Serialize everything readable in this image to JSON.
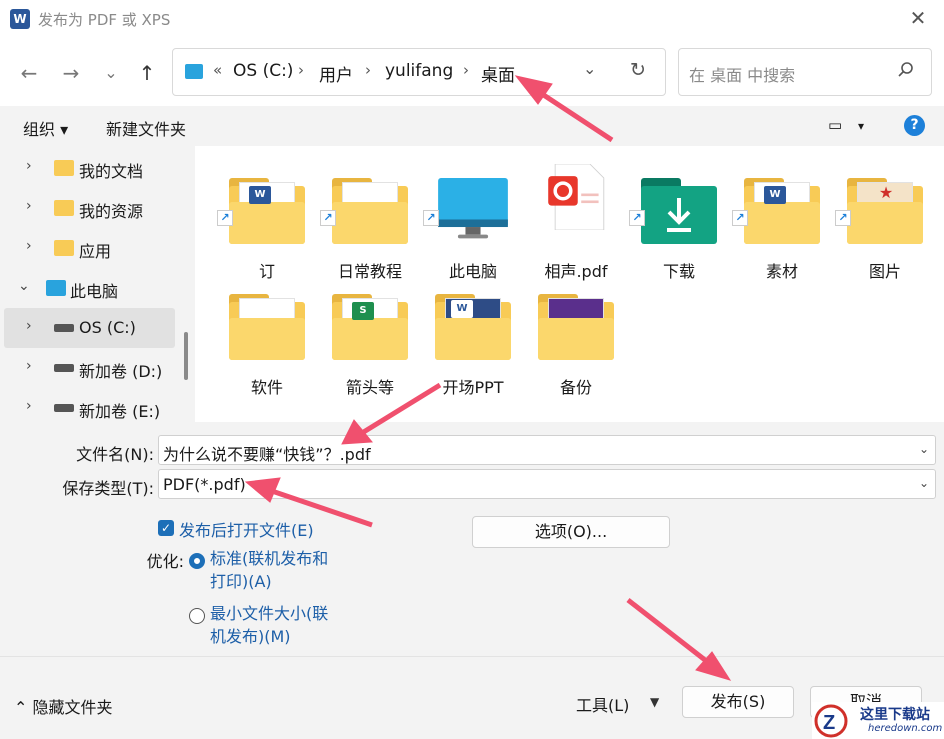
{
  "title_bar": {
    "app_icon": "W",
    "title": "发布为 PDF 或 XPS",
    "close": "✕"
  },
  "nav": {
    "back": "←",
    "forward": "→",
    "dropdown": "⌄",
    "up": "↑",
    "breadcrumb": {
      "overflow": "«",
      "items": [
        "OS (C:)",
        "用户",
        "yulifang",
        "桌面"
      ],
      "separator": "›"
    },
    "refresh": "↻",
    "search": {
      "placeholder": "在 桌面 中搜索",
      "icon": "search-icon"
    }
  },
  "toolbar": {
    "organize": "组织 ▾",
    "new_folder": "新建文件夹",
    "view": "▭",
    "view_chevron": "▾",
    "help": "?"
  },
  "sidebar": {
    "items": [
      {
        "label": "我的文档",
        "icon": "folder-icon",
        "expanded": false
      },
      {
        "label": "我的资源",
        "icon": "folder-icon",
        "expanded": false
      },
      {
        "label": "应用",
        "icon": "apps-folder-icon",
        "expanded": false
      },
      {
        "label": "此电脑",
        "icon": "this-pc-icon",
        "expanded": true
      },
      {
        "label": "OS (C:)",
        "icon": "drive-icon",
        "expanded": false,
        "selected": true
      },
      {
        "label": "新加卷 (D:)",
        "icon": "drive-icon",
        "expanded": false
      },
      {
        "label": "新加卷 (E:)",
        "icon": "drive-icon",
        "expanded": false
      }
    ]
  },
  "files": [
    {
      "label": "订",
      "type": "folder-shortcut"
    },
    {
      "label": "日常教程",
      "type": "folder-shortcut"
    },
    {
      "label": "此电脑",
      "type": "this-pc-shortcut"
    },
    {
      "label": "相声.pdf",
      "type": "pdf"
    },
    {
      "label": "下载",
      "type": "downloads-shortcut"
    },
    {
      "label": "素材",
      "type": "folder-shortcut"
    },
    {
      "label": "图片",
      "type": "folder-shortcut"
    },
    {
      "label": "软件",
      "type": "folder"
    },
    {
      "label": "箭头等",
      "type": "folder"
    },
    {
      "label": "开场PPT",
      "type": "folder"
    },
    {
      "label": "备份",
      "type": "folder"
    }
  ],
  "form": {
    "filename_label": "文件名(N):",
    "filename_value": "为什么说不要赚“快钱”？.pdf",
    "type_label": "保存类型(T):",
    "type_value": "PDF(*.pdf)",
    "open_after_label": "发布后打开文件(E)",
    "open_after_checked": true,
    "options_button": "选项(O)...",
    "optimize_label": "优化:",
    "standard_option": "标准(联机发布和打印)(A)",
    "standard_line1": "标准(联机发布和",
    "standard_line2": "打印)(A)",
    "minimum_line1": "最小文件大小(联",
    "minimum_line2": "机发布)(M)",
    "selected_optimize": "standard"
  },
  "footer": {
    "hide_folders": "隐藏文件夹",
    "tools": "工具(L)",
    "publish": "发布(S)",
    "cancel": "取消"
  },
  "watermark": {
    "text": "这里下载站",
    "sub": "heredown.com"
  },
  "colors": {
    "accent": "#1d6fb8",
    "folder": "#f8cb56",
    "annotation_arrow": "#f0506e"
  }
}
